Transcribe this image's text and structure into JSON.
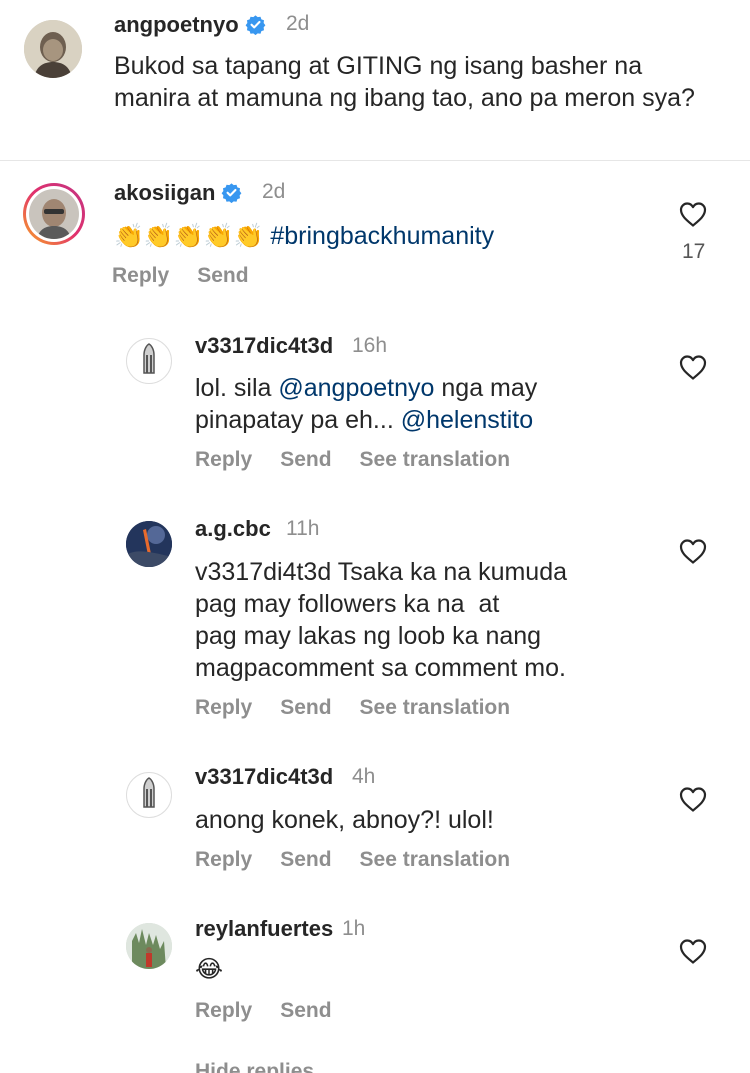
{
  "comments": [
    {
      "username": "angpoetnyo",
      "verified": true,
      "time": "2d",
      "text": "Bukod sa tapang at GITING ng isang basher na manira at mamuna ng ibang tao, ano pa meron sya?"
    },
    {
      "username": "akosiigan",
      "verified": true,
      "time": "2d",
      "emoji": "👏👏👏👏👏",
      "hashtag": "#bringbackhumanity",
      "likes": "17",
      "reply_label": "Reply",
      "send_label": "Send"
    }
  ],
  "replies": [
    {
      "username": "v3317dic4t3d",
      "time": "16h",
      "text_line1_prefix": "lol. sila ",
      "mention1": "@angpoetnyo",
      "text_line1_suffix": " nga may",
      "text_line2_prefix": "pinapatay pa eh... ",
      "mention2": "@helenstito",
      "reply_label": "Reply",
      "send_label": "Send",
      "translate_label": "See translation"
    },
    {
      "username": "a.g.cbc",
      "time": "11h",
      "text": "v3317di4t3d Tsaka ka na kumuda pag may followers ka na  at pag may lakas ng loob ka nang magpacomment sa comment mo.",
      "line1": "v3317di4t3d Tsaka ka na kumuda",
      "line2": "pag may followers ka na  at",
      "line3": "pag may lakas ng loob ka nang",
      "line4": "magpacomment sa comment mo.",
      "reply_label": "Reply",
      "send_label": "Send",
      "translate_label": "See translation"
    },
    {
      "username": "v3317dic4t3d",
      "time": "4h",
      "text": "anong konek, abnoy?! ulol!",
      "reply_label": "Reply",
      "send_label": "Send",
      "translate_label": "See translation"
    },
    {
      "username": "reylanfuertes",
      "time": "1h",
      "emoji": "😂",
      "reply_label": "Reply",
      "send_label": "Send"
    }
  ],
  "hide_replies_label": "Hide replies",
  "colors": {
    "verified": "#3897f0",
    "secondary_text": "#8e8e8e",
    "mention": "#00376b"
  }
}
